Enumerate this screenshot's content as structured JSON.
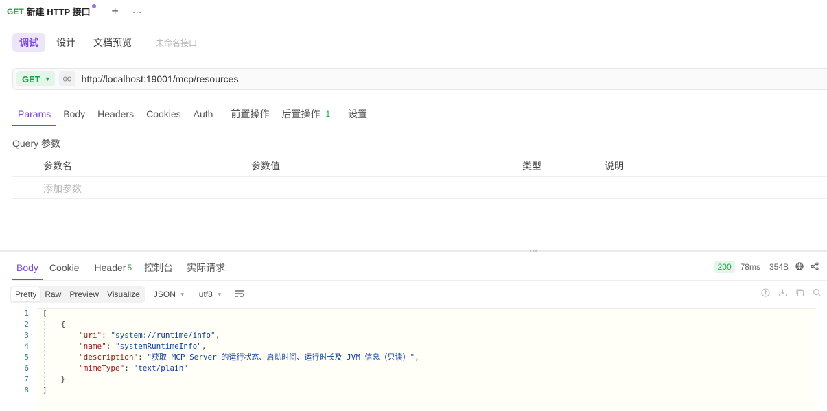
{
  "tab": {
    "method": "GET",
    "title": "新建 HTTP 接口"
  },
  "tab_actions": {
    "add_icon": "+",
    "more_icon": "···"
  },
  "modes": [
    {
      "label": "调试",
      "active": true
    },
    {
      "label": "设计",
      "active": false
    },
    {
      "label": "文档预览",
      "active": false
    }
  ],
  "api_name_placeholder": "未命名接口",
  "request": {
    "method": "GET",
    "url": "http://localhost:19001/mcp/resources"
  },
  "request_tabs": [
    {
      "label": "Params",
      "active": true,
      "badge": ""
    },
    {
      "label": "Body",
      "active": false,
      "badge": ""
    },
    {
      "label": "Headers",
      "active": false,
      "badge": ""
    },
    {
      "label": "Cookies",
      "active": false,
      "badge": ""
    },
    {
      "label": "Auth",
      "active": false,
      "badge": ""
    },
    {
      "label": "前置操作",
      "active": false,
      "badge": ""
    },
    {
      "label": "后置操作",
      "active": false,
      "badge": "1"
    },
    {
      "label": "设置",
      "active": false,
      "badge": ""
    }
  ],
  "query": {
    "label": "Query 参数",
    "columns": [
      "参数名",
      "参数值",
      "类型",
      "说明"
    ],
    "add_placeholder": "添加参数"
  },
  "response_tabs": [
    {
      "label": "Body",
      "active": true,
      "badge": ""
    },
    {
      "label": "Cookie",
      "active": false,
      "badge": ""
    },
    {
      "label": "Header",
      "active": false,
      "badge": "5"
    },
    {
      "label": "控制台",
      "active": false,
      "badge": ""
    },
    {
      "label": "实际请求",
      "active": false,
      "badge": ""
    }
  ],
  "stats": {
    "status": "200",
    "time": "78ms",
    "size": "354B"
  },
  "format": {
    "views": [
      {
        "label": "Pretty",
        "active": true
      },
      {
        "label": "Raw",
        "active": false
      },
      {
        "label": "Preview",
        "active": false
      },
      {
        "label": "Visualize",
        "active": false
      }
    ],
    "language": "JSON",
    "encoding": "utf8"
  },
  "colors": {
    "accent": "#7a45e5",
    "method": "#17a34a",
    "status_ok": "#17a34a"
  },
  "code_lines": [
    "[",
    "    {",
    "        \"uri\": \"system://runtime/info\",",
    "        \"name\": \"systemRuntimeInfo\",",
    "        \"description\": \"获取 MCP Server 的运行状态、启动时间、运行时长及 JVM 信息（只读）\",",
    "        \"mimeType\": \"text/plain\"",
    "    }",
    "]"
  ]
}
